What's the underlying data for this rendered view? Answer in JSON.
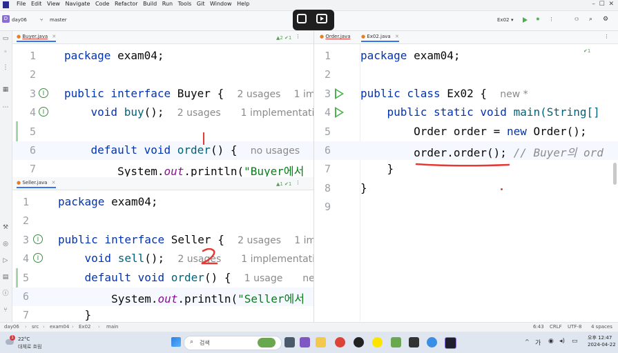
{
  "menu": [
    "File",
    "Edit",
    "View",
    "Navigate",
    "Code",
    "Refactor",
    "Build",
    "Run",
    "Tools",
    "Git",
    "Window",
    "Help"
  ],
  "toolbar": {
    "project_badge": "D",
    "project": "day06",
    "branch": "master",
    "run_config": "Ex02"
  },
  "left_pane": {
    "tab": {
      "label": "Buyer.java",
      "inspect": "▲2 ✔1"
    },
    "lines": [
      {
        "n": "1"
      },
      {
        "n": "2"
      },
      {
        "n": "3"
      },
      {
        "n": "4"
      },
      {
        "n": "5"
      },
      {
        "n": "6"
      },
      {
        "n": "7"
      }
    ],
    "hints": {
      "l3_usages": "2 usages",
      "l3_impl": "1 im",
      "l4_usages": "2 usages",
      "l4_impl": "1 implementatio",
      "l6_usages": "no usages"
    },
    "code": {
      "pkg": "exam04",
      "iface": "Buyer",
      "method": "buy",
      "default_method": "order",
      "println_str": "\"Buyer에서"
    }
  },
  "left_bottom_pane": {
    "tab": {
      "label": "Seller.java",
      "inspect": "▲1 ✔1"
    },
    "lines": [
      {
        "n": "1"
      },
      {
        "n": "2"
      },
      {
        "n": "3"
      },
      {
        "n": "4"
      },
      {
        "n": "5"
      },
      {
        "n": "6"
      },
      {
        "n": "7"
      }
    ],
    "hints": {
      "l3_usages": "2 usages",
      "l3_impl": "1 im",
      "l4_usages": "2 usages",
      "l4_impl": "1 implementatio",
      "l5_usages": "1 usage",
      "l5_new": "new"
    },
    "code": {
      "pkg": "exam04",
      "iface": "Seller",
      "method": "sell",
      "default_method": "order",
      "println_str": "\"Seller에서"
    }
  },
  "right_pane": {
    "tabs": [
      {
        "label": "Order.java"
      },
      {
        "label": "Ex02.java"
      }
    ],
    "inspect": "✔1",
    "lines": [
      {
        "n": "1"
      },
      {
        "n": "2"
      },
      {
        "n": "3"
      },
      {
        "n": "4"
      },
      {
        "n": "5"
      },
      {
        "n": "6"
      },
      {
        "n": "7"
      },
      {
        "n": "8"
      },
      {
        "n": "9"
      }
    ],
    "hints": {
      "l3_new": "new *"
    },
    "code": {
      "pkg": "exam04",
      "cls": "Ex02",
      "main_sig": "main(String[]",
      "decl_type": "Order",
      "decl_var": "order",
      "ctor": "Order",
      "call": "order.order();",
      "comment": "// Buyer의 ord"
    }
  },
  "statusbar": {
    "breadcrumb": [
      "day06",
      "src",
      "exam04",
      "Ex02",
      "main"
    ],
    "pos": "6:43",
    "eol": "CRLF",
    "enc": "UTF-8",
    "indent": "4 spaces"
  },
  "taskbar": {
    "weather_temp": "22°C",
    "weather_desc": "대체로 흐림",
    "search": "검색",
    "ime": "가",
    "time": "오후 12:47",
    "date": "2024-04-22",
    "weather_badge": "1"
  },
  "annotations": {
    "mark_2": "2"
  },
  "colors": {
    "keyword": "#0033b3",
    "string": "#067d17",
    "annotation_red": "#e53935",
    "accent": "#3574f0"
  }
}
